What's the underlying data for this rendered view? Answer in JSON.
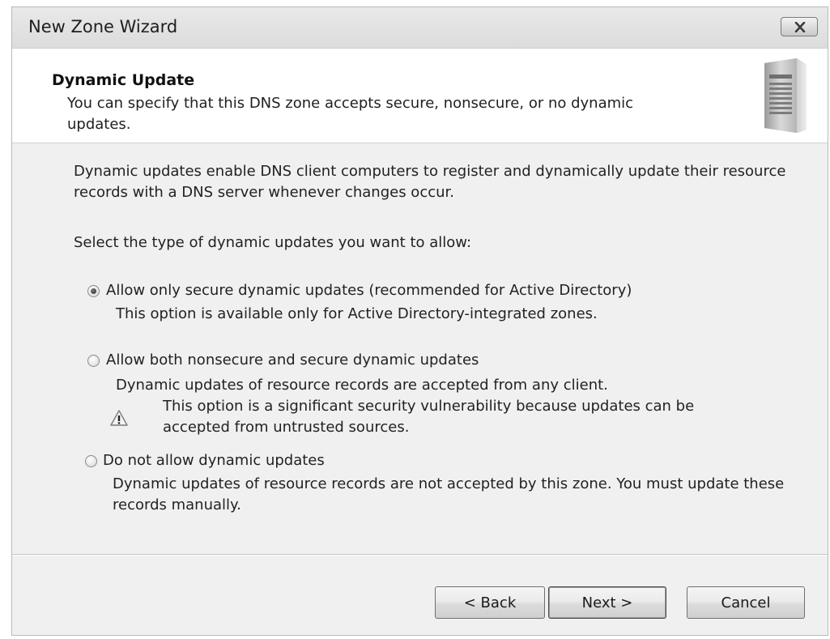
{
  "window": {
    "title": "New Zone Wizard"
  },
  "header": {
    "title": "Dynamic Update",
    "description": "You can specify that this DNS zone accepts secure, nonsecure, or no dynamic updates.",
    "icon": "server-icon"
  },
  "body": {
    "intro": "Dynamic updates enable DNS client computers to register and dynamically update their resource records with a DNS server whenever changes occur.",
    "prompt": "Select the type of dynamic updates you want to allow:",
    "options": [
      {
        "label": "Allow only secure dynamic updates (recommended for Active Directory)",
        "description": "This option is available only for Active Directory-integrated zones.",
        "selected": true
      },
      {
        "label": "Allow both nonsecure and secure dynamic updates",
        "description": "Dynamic updates of resource records are accepted from any client.",
        "warning": "This option is a significant security vulnerability because updates can be accepted from untrusted sources.",
        "selected": false
      },
      {
        "label": "Do not allow dynamic updates",
        "description": "Dynamic updates of resource records are not accepted by this zone. You must update these records manually.",
        "selected": false
      }
    ]
  },
  "buttons": {
    "back": "< Back",
    "next": "Next >",
    "cancel": "Cancel"
  },
  "colors": {
    "dialog_bg": "#f0f0f0",
    "header_bg": "#ffffff"
  }
}
